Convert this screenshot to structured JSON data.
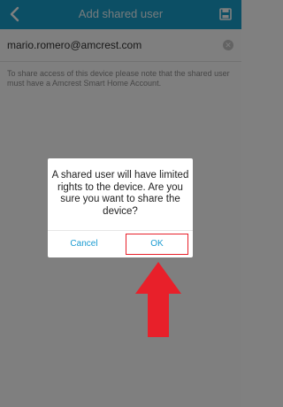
{
  "header": {
    "title": "Add shared user",
    "back_icon": "chevron-left-icon",
    "save_icon": "save-icon"
  },
  "form": {
    "email_value": "mario.romero@amcrest.com",
    "clear_icon": "clear-icon",
    "notice": "To share access of this device please note that the shared user must have a Amcrest Smart Home Account."
  },
  "dialog": {
    "message": "A shared user will have limited rights to the device. Are you sure you want to share the device?",
    "cancel_label": "Cancel",
    "ok_label": "OK"
  },
  "colors": {
    "header_bg": "#199fca",
    "button_text": "#1a9bd1",
    "highlight_box": "#e8202a",
    "arrow": "#e8202a"
  }
}
